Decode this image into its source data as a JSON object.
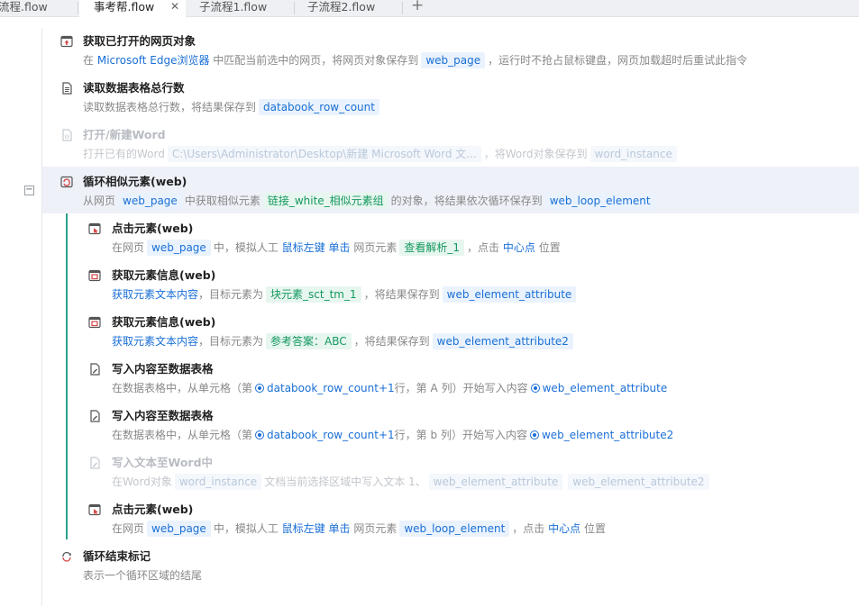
{
  "tabs": [
    {
      "label": "流程.flow",
      "active": false
    },
    {
      "label": "事考帮.flow",
      "active": true
    },
    {
      "label": "子流程1.flow",
      "active": false
    },
    {
      "label": "子流程2.flow",
      "active": false
    }
  ],
  "tab_close_glyph": "✕",
  "tab_add_glyph": "+",
  "collapse_glyph": "−",
  "steps": {
    "s1": {
      "title": "获取已打开的网页对象",
      "d": [
        "在",
        "Microsoft Edge浏览器",
        "中匹配当前选中的网页，将网页对象保存到",
        "web_page",
        "，运行时不抢占鼠标键盘，网页加载超时后重试此指令"
      ]
    },
    "s2": {
      "title": "读取数据表格总行数",
      "d": [
        "读取数据表格总行数，将结果保存到",
        "databook_row_count"
      ]
    },
    "s3": {
      "title": "打开/新建Word",
      "d": [
        "打开已有的Word",
        "C:\\Users\\Administrator\\Desktop\\新建 Microsoft Word 文...",
        "，将Word对象保存到",
        "word_instance"
      ]
    },
    "s4": {
      "title": "循环相似元素(web)",
      "d": [
        "从网页",
        "web_page",
        "中获取相似元素",
        "链接_white_相似元素组",
        "的对象，将结果依次循环保存到",
        "web_loop_element"
      ]
    },
    "s5": {
      "title": "点击元素(web)",
      "d": [
        "在网页",
        "web_page",
        "中，模拟人工",
        "鼠标左键",
        "单击",
        "网页元素",
        "查看解析_1",
        "，点击",
        "中心点",
        "位置"
      ]
    },
    "s6": {
      "title": "获取元素信息(web)",
      "d": [
        "获取元素文本内容",
        "，目标元素为",
        "块元素_sct_tm_1",
        "，将结果保存到",
        "web_element_attribute"
      ]
    },
    "s7": {
      "title": "获取元素信息(web)",
      "d": [
        "获取元素文本内容",
        "，目标元素为",
        "参考答案：ABC",
        "，将结果保存到",
        "web_element_attribute2"
      ]
    },
    "s8": {
      "title": "写入内容至数据表格",
      "d": [
        "在数据表格中，从单元格（第",
        "databook_row_count+1",
        "行，第",
        "A",
        "列）开始写入内容",
        "web_element_attribute"
      ]
    },
    "s9": {
      "title": "写入内容至数据表格",
      "d": [
        "在数据表格中，从单元格（第",
        "databook_row_count+1",
        "行，第",
        "b",
        "列）开始写入内容",
        "web_element_attribute2"
      ]
    },
    "s10": {
      "title": "写入文本至Word中",
      "d": [
        "在Word对象",
        "word_instance",
        "文档当前选择区域中写入文本 1、",
        "web_element_attribute",
        "web_element_attribute2"
      ]
    },
    "s11": {
      "title": "点击元素(web)",
      "d": [
        "在网页",
        "web_page",
        "中，模拟人工",
        "鼠标左键",
        "单击",
        "网页元素",
        "web_loop_element",
        "，点击",
        "中心点",
        "位置"
      ]
    },
    "s12": {
      "title": "循环结束标记",
      "d": [
        "表示一个循环区域的结尾"
      ]
    }
  },
  "colors": {
    "accent": "#1a6fd6",
    "green": "#15985f",
    "loop_bar": "#2aa38a",
    "icon_red": "#d64545"
  }
}
